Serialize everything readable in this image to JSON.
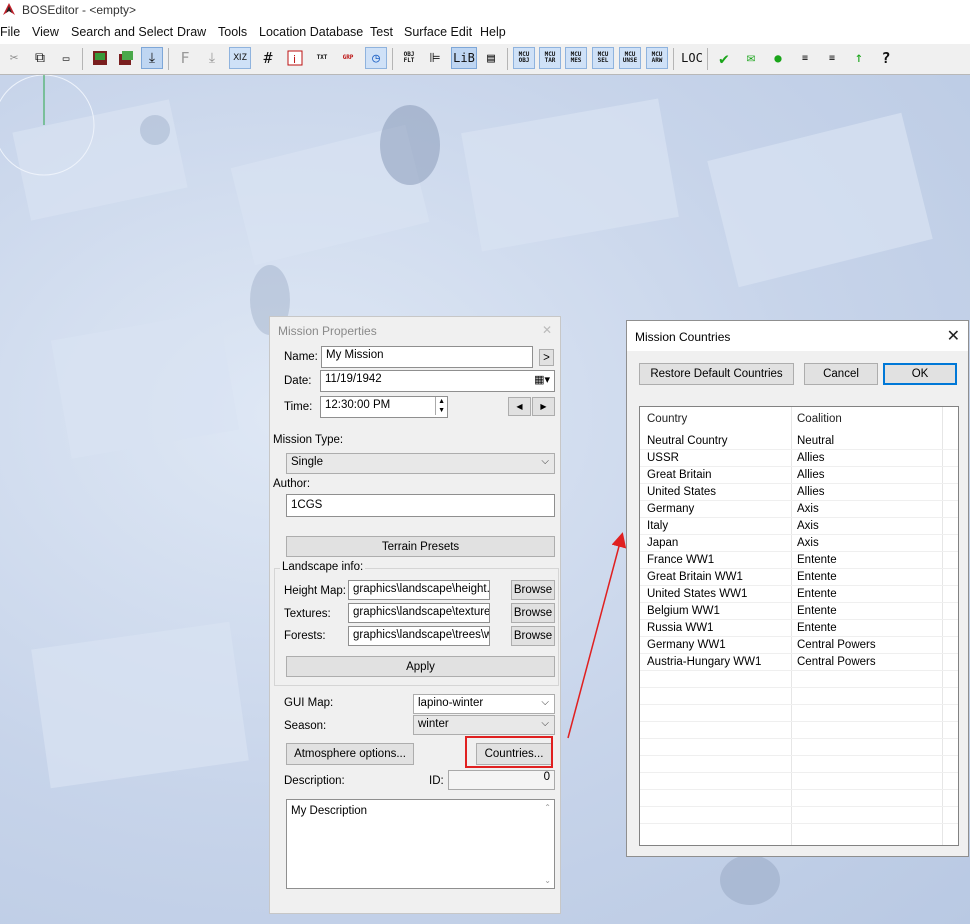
{
  "window": {
    "title": "BOSEditor - <empty>"
  },
  "menu": [
    "File",
    "View",
    "Search and Select",
    "Draw",
    "Tools",
    "Location Database",
    "Test",
    "Surface Edit",
    "Help"
  ],
  "toolbar": {
    "text_labels": {
      "f": "F",
      "txt": "TXT",
      "grp": "GRP",
      "objflt": "OBJ FLT",
      "lib": "LiB",
      "loc": "LOC"
    },
    "mcu_labels": [
      "MCU OBJ",
      "MCU TAR",
      "MCU MES",
      "MCU SEL",
      "MCU UNSE",
      "MCU ARW"
    ]
  },
  "mission_properties": {
    "title": "Mission Properties",
    "name_label": "Name:",
    "name_value": "My Mission",
    "name_btn": ">",
    "date_label": "Date:",
    "date_value": "11/19/1942",
    "time_label": "Time:",
    "time_value": "12:30:00 PM",
    "mission_type_label": "Mission Type:",
    "mission_type_value": "Single",
    "author_label": "Author:",
    "author_value": "1CGS",
    "terrain_presets_btn": "Terrain Presets",
    "landscape_label": "Landscape info:",
    "height_map_label": "Height Map:",
    "height_map_value": "graphics\\landscape\\height.h",
    "textures_label": "Textures:",
    "textures_value": "graphics\\landscape\\texture",
    "forests_label": "Forests:",
    "forests_value": "graphics\\landscape\\trees\\w",
    "browse_label": "Browse",
    "apply_btn": "Apply",
    "gui_map_label": "GUI Map:",
    "gui_map_value": "lapino-winter",
    "season_label": "Season:",
    "season_value": "winter",
    "atmosphere_btn": "Atmosphere options...",
    "countries_btn": "Countries...",
    "description_label": "Description:",
    "id_label": "ID:",
    "id_value": "0",
    "description_value": "My Description"
  },
  "mission_countries": {
    "title": "Mission Countries",
    "restore_btn": "Restore Default Countries",
    "cancel_btn": "Cancel",
    "ok_btn": "OK",
    "columns": [
      "Country",
      "Coalition"
    ],
    "rows": [
      {
        "country": "Neutral Country",
        "coalition": "Neutral"
      },
      {
        "country": "USSR",
        "coalition": "Allies"
      },
      {
        "country": "Great Britain",
        "coalition": "Allies"
      },
      {
        "country": "United States",
        "coalition": "Allies"
      },
      {
        "country": "Germany",
        "coalition": "Axis"
      },
      {
        "country": "Italy",
        "coalition": "Axis"
      },
      {
        "country": "Japan",
        "coalition": "Axis"
      },
      {
        "country": "France WW1",
        "coalition": "Entente"
      },
      {
        "country": "Great Britain WW1",
        "coalition": "Entente"
      },
      {
        "country": "United States WW1",
        "coalition": "Entente"
      },
      {
        "country": "Belgium WW1",
        "coalition": "Entente"
      },
      {
        "country": "Russia WW1",
        "coalition": "Entente"
      },
      {
        "country": "Germany WW1",
        "coalition": "Central Powers"
      },
      {
        "country": "Austria-Hungary WW1",
        "coalition": "Central Powers"
      }
    ]
  },
  "colors": {
    "accent": "#e02020",
    "selection": "#0078d7",
    "map": "#c9d6ea"
  }
}
